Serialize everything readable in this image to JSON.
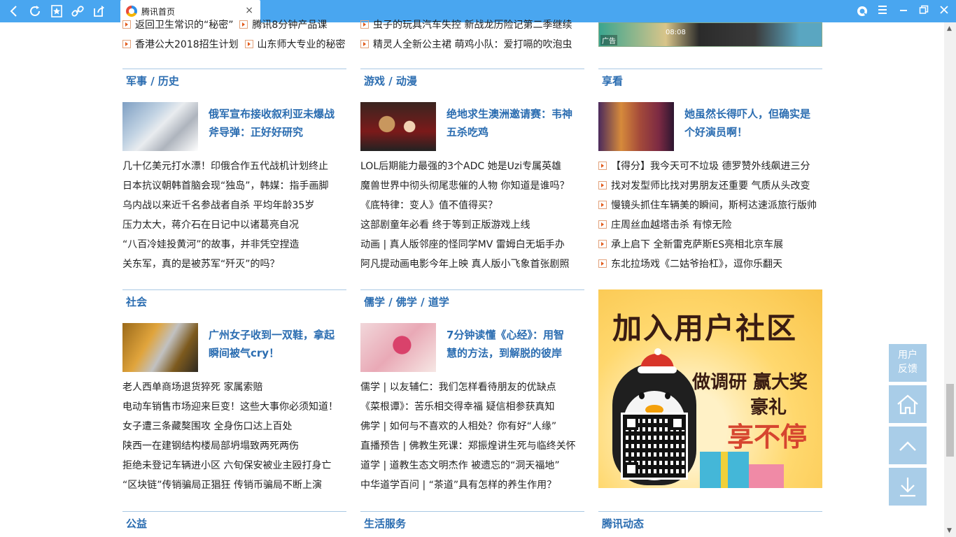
{
  "browser": {
    "tab_title": "腾讯首页",
    "nav_icons": [
      "back-icon",
      "refresh-icon",
      "bookmark-icon",
      "link-icon",
      "share-icon"
    ],
    "close_glyph": "×"
  },
  "top_partial": {
    "col1_row0": [
      "返回卫生常识的“秘密”",
      "腾讯8分钟产品课"
    ],
    "col1_row1": [
      "香港公大2018招生计划",
      "山东师大专业的秘密"
    ],
    "col2_row0": "虫子的玩具汽车失控 新战龙历险记第二季继续",
    "col2_row1": "精灵人全新公主裙 萌鸡小队：爱打嗝的吹泡虫",
    "ad_label": "广告",
    "ad_clock": "08:08"
  },
  "sections": {
    "military": {
      "title": "军事 / 历史",
      "feature": "俄军宣布接收叙利亚未爆战斧导弹：正好好研究",
      "items": [
        "几十亿美元打水漂！印俄合作五代战机计划终止",
        "日本抗议朝韩首脑会现“独岛”，韩媒：指手画脚",
        "乌内战以来近千名参战者自杀 平均年龄35岁",
        "压力太大，蒋介石在日记中以诸葛亮自况",
        "“八百冷娃投黄河”的故事，并非凭空捏造",
        "关东军，真的是被苏军“歼灭”的吗？"
      ]
    },
    "games": {
      "title": "游戏 / 动漫",
      "feature": "绝地求生澳洲邀请赛：韦神五杀吃鸡",
      "items": [
        "LOL后期能力最强的3个ADC 她是Uzi专属英雄",
        "魔兽世界中彻头彻尾悲催的人物 你知道是谁吗？",
        "《底特律：变人》值不值得买？",
        "这部剧童年必看 终于等到正版游戏上线",
        "动画 | 真人版邻座的怪同学MV 雷姆白无垢手办",
        "阿凡提动画电影今年上映 真人版小飞象首张剧照"
      ]
    },
    "xiangkan": {
      "title": "享看",
      "feature": "她虽然长得吓人，但确实是个好演员啊！",
      "items": [
        "【得分】我今天可不垃圾 德罗赞外线飙进三分",
        "找对发型师比找对男朋友还重要 气质从头改变",
        "慢镜头抓住车辆美的瞬间，斯柯达速派旅行版帅",
        "庄周丝血越塔击杀 有惊无险",
        "承上启下 全新雷克萨斯ES亮相北京车展",
        "东北拉场戏《二姑爷抬杠》，逗你乐翻天"
      ]
    },
    "society": {
      "title": "社会",
      "feature": "广州女子收到一双鞋，拿起瞬间被气cry！",
      "items": [
        "老人西单商场退货猝死 家属索赔",
        "电动车销售市场迎来巨变！这些大事你必须知道！",
        "女子遭三条藏獒围攻 全身伤口达上百处",
        "陕西一在建钢结构楼局部坍塌致两死两伤",
        "拒绝未登记车辆进小区 六旬保安被业主殴打身亡",
        "“区块链”传销骗局正猖狂 传销币骗局不断上演"
      ]
    },
    "religion": {
      "title": "儒学 / 佛学 / 道学",
      "feature": "7分钟读懂《心经》：用智慧的方法，到解脱的彼岸",
      "items": [
        "儒学 | 以友辅仁：我们怎样看待朋友的优缺点",
        "《菜根谭》：苦乐相交得幸福 疑信相参获真知",
        "佛学 | 如何与不喜欢的人相处？你有好“人缘”",
        "直播预告 | 佛教生死课：郑振煌讲生死与临终关怀",
        "道学 | 道教生态文明杰作 被遗忘的“洞天福地”",
        "中华道学百问 | “茶道”具有怎样的养生作用？"
      ]
    },
    "bottom": [
      "公益",
      "生活服务",
      "腾讯动态"
    ]
  },
  "promo": {
    "title": "加入用户社区",
    "line1": "做调研 赢大奖",
    "line2": "豪礼",
    "line3": "享不停"
  },
  "floating": {
    "feedback": "用户反馈",
    "icons": [
      "home-icon",
      "scroll-up-icon",
      "download-icon"
    ]
  },
  "colors": {
    "topbar": "#49a6f0",
    "section_title": "#2b6db1",
    "arrow": "#e25b1b",
    "float_btn": "#a9cde8"
  }
}
